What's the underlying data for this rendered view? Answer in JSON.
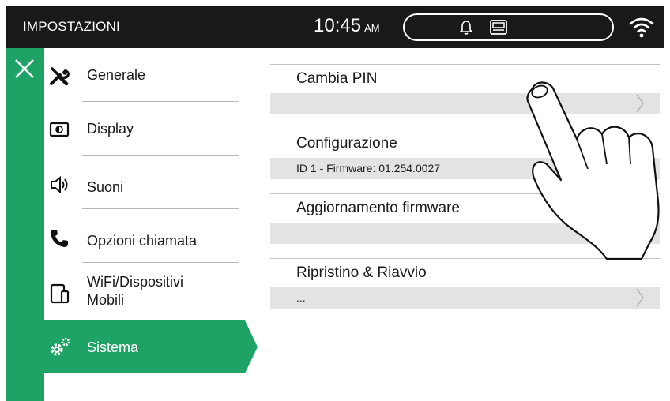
{
  "header": {
    "title": "IMPOSTAZIONI",
    "time": "10:45",
    "ampm": "AM",
    "status_icons": [
      "bell-icon",
      "intercom-icon"
    ],
    "wifi_icon": "wifi-icon"
  },
  "rail": {
    "close_icon": "close-icon"
  },
  "sidebar": {
    "items": [
      {
        "label": "Generale",
        "icon": "wrench-screwdriver-icon"
      },
      {
        "label": "Display",
        "icon": "display-icon"
      },
      {
        "label": "Suoni",
        "icon": "speaker-icon"
      },
      {
        "label": "Opzioni chiamata",
        "icon": "phone-icon"
      },
      {
        "label": "WiFi/Dispositivi",
        "label2": "Mobili",
        "icon": "mobile-devices-icon"
      },
      {
        "label": "Sistema",
        "icon": "gears-icon",
        "selected": true
      }
    ]
  },
  "settings": {
    "rows": [
      {
        "title": "Cambia PIN",
        "subtitle": ""
      },
      {
        "title": "Configurazione",
        "subtitle": "ID 1 - Firmware: 01.254.0027"
      },
      {
        "title": "Aggiornamento firmware",
        "subtitle": ""
      },
      {
        "title": "Ripristino & Riavvio",
        "subtitle": "..."
      }
    ]
  },
  "colors": {
    "accent": "#1fa265",
    "header_bg": "#191919",
    "row_sub_bg": "#e3e3e3"
  },
  "overlay": {
    "icon": "pointing-hand-icon"
  }
}
